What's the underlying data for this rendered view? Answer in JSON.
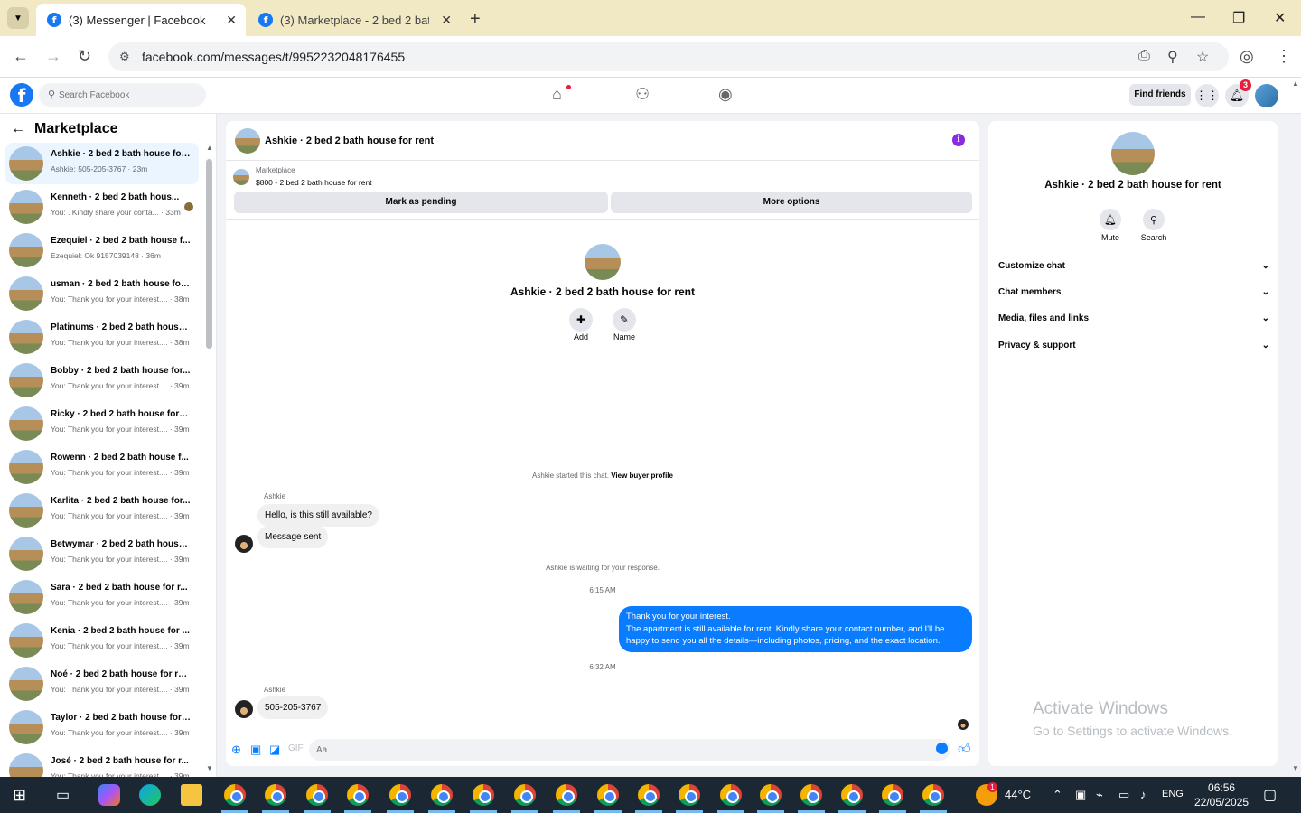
{
  "browser": {
    "tabs": [
      {
        "title": "(3) Messenger | Facebook",
        "active": true
      },
      {
        "title": "(3) Marketplace - 2 bed 2 bath",
        "active": false
      }
    ],
    "url": "facebook.com/messages/t/9952232048176455"
  },
  "fb_header": {
    "search_placeholder": "Search Facebook",
    "find_friends": "Find friends",
    "notification_count": "3"
  },
  "left_pane": {
    "title": "Marketplace",
    "conversations": [
      {
        "name": "Ashkie · 2 bed 2 bath house for...",
        "snippet": "Ashkie: 505-205-3767 · 23m",
        "active": true
      },
      {
        "name": "Kenneth · 2 bed 2 bath hous...",
        "snippet": "You: . Kindly share your conta... · 33m"
      },
      {
        "name": "Ezequiel · 2 bed 2 bath house f...",
        "snippet": "Ezequiel: Ok 9157039148 · 36m"
      },
      {
        "name": "usman · 2 bed 2 bath house for...",
        "snippet": "You: Thank you for your interest.... · 38m"
      },
      {
        "name": "Platinums · 2 bed 2 bath house...",
        "snippet": "You: Thank you for your interest.... · 38m"
      },
      {
        "name": "Bobby · 2 bed 2 bath house for...",
        "snippet": "You: Thank you for your interest.... · 39m"
      },
      {
        "name": "Ricky · 2 bed 2 bath house for r...",
        "snippet": "You: Thank you for your interest.... · 39m"
      },
      {
        "name": "Rowenn · 2 bed 2 bath house f...",
        "snippet": "You: Thank you for your interest.... · 39m"
      },
      {
        "name": "Karlita · 2 bed 2 bath house for...",
        "snippet": "You: Thank you for your interest.... · 39m"
      },
      {
        "name": "Betwymar · 2 bed 2 bath house...",
        "snippet": "You: Thank you for your interest.... · 39m"
      },
      {
        "name": "Sara · 2 bed 2 bath house for r...",
        "snippet": "You: Thank you for your interest.... · 39m"
      },
      {
        "name": "Kenia · 2 bed 2 bath house for ...",
        "snippet": "You: Thank you for your interest.... · 39m"
      },
      {
        "name": "Noé · 2 bed 2 bath house for re...",
        "snippet": "You: Thank you for your interest.... · 39m"
      },
      {
        "name": "Taylor · 2 bed 2 bath house for ...",
        "snippet": "You: Thank you for your interest.... · 39m"
      },
      {
        "name": "José · 2 bed 2 bath house for r...",
        "snippet": "You: Thank you for your interest.... · 39m"
      }
    ]
  },
  "chat": {
    "title": "Ashkie · 2 bed 2 bath house for rent",
    "listing_label": "Marketplace",
    "listing_price": "$800 - 2 bed 2 bath house for rent",
    "mark_pending": "Mark as pending",
    "more_options": "More options",
    "intro_name": "Ashkie · 2 bed 2 bath house for rent",
    "add_label": "Add",
    "name_label": "Name",
    "started_text": "Ashkie started this chat.",
    "view_buyer": "View buyer profile",
    "sender_name": "Ashkie",
    "msg1": "Hello, is this still available?",
    "msg2": "Message sent",
    "waiting": "Ashkie is waiting for your response.",
    "time1": "6:15 AM",
    "reply_line1": "Thank you for your interest.",
    "reply_line2": "The apartment is still available for rent. Kindly share your contact number, and I'll be happy to send you all the details—including photos, pricing, and the exact location.",
    "time2": "6:32 AM",
    "msg3": "505-205-3767",
    "composer_placeholder": "Aa"
  },
  "right_panel": {
    "name": "Ashkie · 2 bed 2 bath house for rent",
    "mute": "Mute",
    "search": "Search",
    "sections": [
      "Customize chat",
      "Chat members",
      "Media, files and links",
      "Privacy & support"
    ],
    "watermark_title": "Activate Windows",
    "watermark_sub": "Go to Settings to activate Windows."
  },
  "taskbar": {
    "weather": "44°C",
    "lang": "ENG",
    "time": "06:56",
    "date": "22/05/2025",
    "weather_badge": "1"
  }
}
